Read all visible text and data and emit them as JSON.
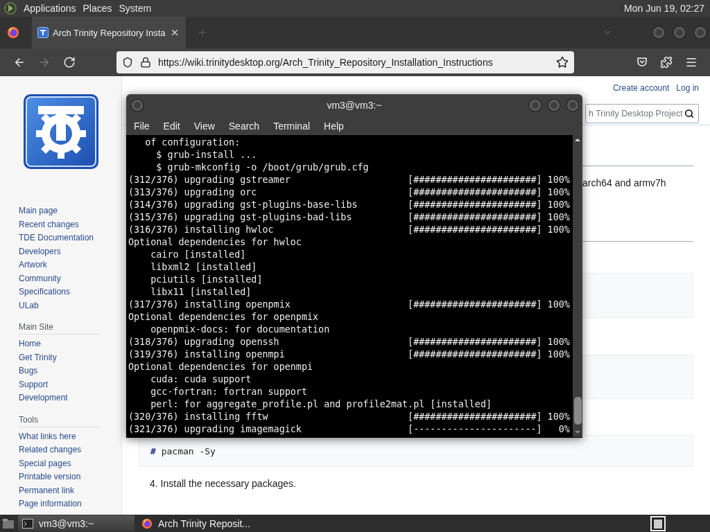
{
  "top_panel": {
    "menus": [
      "Applications",
      "Places",
      "System"
    ],
    "clock": "Mon Jun 19, 02:27"
  },
  "browser": {
    "tabs": [
      {
        "title": "Arch Trinity Repository Insta",
        "selected": true
      }
    ],
    "nav_buttons": [
      {
        "kind": "back",
        "disabled": false
      },
      {
        "kind": "forward",
        "disabled": true
      },
      {
        "kind": "reload",
        "disabled": false
      }
    ],
    "url": "https://wiki.trinitydesktop.org/Arch_Trinity_Repository_Installation_Instructions",
    "page": {
      "personal_links": [
        "Create account",
        "Log in"
      ],
      "search": {
        "placeholder": "h Trinity Desktop Project"
      },
      "sidebar": {
        "links": [
          "Main page",
          "Recent changes",
          "TDE Documentation",
          "Developers",
          "Artwork",
          "Community",
          "Specifications",
          "ULab"
        ],
        "sections": [
          {
            "title": "Main Site",
            "links": [
              "Home",
              "Get Trinity",
              "Bugs",
              "Support",
              "Development"
            ]
          },
          {
            "title": "Tools",
            "links": [
              "What links here",
              "Related changes",
              "Special pages",
              "Printable version",
              "Permanent link",
              "Page information"
            ]
          }
        ]
      },
      "content": {
        "paragraph": "arch64 and armv7h",
        "code": "**#** pacman -Sy",
        "step": "4. Install the necessary packages."
      }
    }
  },
  "terminal": {
    "title": "vm3@vm3:~",
    "menu": [
      "File",
      "Edit",
      "View",
      "Search",
      "Terminal",
      "Help"
    ],
    "lines": [
      {
        "text": "   of configuration:"
      },
      {
        "text": "     $ grub-install ..."
      },
      {
        "text": "     $ grub-mkconfig -o /boot/grub/grub.cfg"
      },
      {
        "text": "(312/376) upgrading gstreamer",
        "bar": "[######################]",
        "percent": "100%"
      },
      {
        "text": "(313/376) upgrading orc",
        "bar": "[######################]",
        "percent": "100%"
      },
      {
        "text": "(314/376) upgrading gst-plugins-base-libs",
        "bar": "[######################]",
        "percent": "100%"
      },
      {
        "text": "(315/376) upgrading gst-plugins-bad-libs",
        "bar": "[######################]",
        "percent": "100%"
      },
      {
        "text": "(316/376) installing hwloc",
        "bar": "[######################]",
        "percent": "100%"
      },
      {
        "text": "Optional dependencies for hwloc"
      },
      {
        "text": "    cairo [installed]"
      },
      {
        "text": "    libxml2 [installed]"
      },
      {
        "text": "    pciutils [installed]"
      },
      {
        "text": "    libx11 [installed]"
      },
      {
        "text": "(317/376) installing openpmix",
        "bar": "[######################]",
        "percent": "100%"
      },
      {
        "text": "Optional dependencies for openpmix"
      },
      {
        "text": "    openpmix-docs: for documentation"
      },
      {
        "text": "(318/376) upgrading openssh",
        "bar": "[######################]",
        "percent": "100%"
      },
      {
        "text": "(319/376) installing openmpi",
        "bar": "[######################]",
        "percent": "100%"
      },
      {
        "text": "Optional dependencies for openmpi"
      },
      {
        "text": "    cuda: cuda support"
      },
      {
        "text": "    gcc-fortran: fortran support"
      },
      {
        "text": "    perl: for aggregate_profile.pl and profile2mat.pl [installed]"
      },
      {
        "text": "(320/376) installing fftw",
        "bar": "[######################]",
        "percent": "100%"
      },
      {
        "text": "(321/376) upgrading imagemagick",
        "bar": "[----------------------]",
        "percent": "0%"
      }
    ]
  },
  "taskbar": {
    "tasks": [
      {
        "kind": "terminal",
        "label": "vm3@vm3:~",
        "selected": true
      },
      {
        "kind": "browser",
        "label": "Arch Trinity Reposit...",
        "selected": false
      }
    ]
  }
}
